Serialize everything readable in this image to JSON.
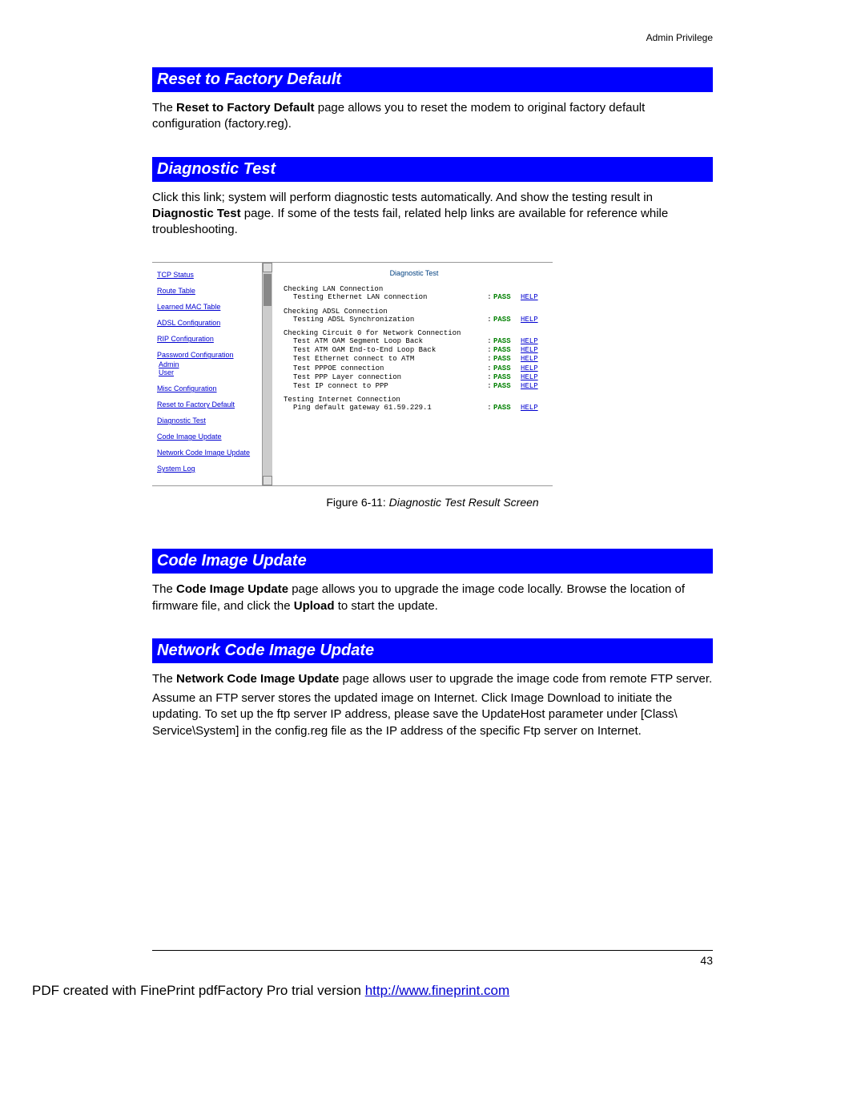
{
  "header_right": "Admin Privilege",
  "sections": {
    "reset": {
      "title": "Reset to Factory Default",
      "text_pre": "The ",
      "text_bold": "Reset to Factory Default",
      "text_post": " page allows you to reset the modem to original factory default configuration (factory.reg)."
    },
    "diag": {
      "title": "Diagnostic Test",
      "text_pre": "Click this link; system will perform diagnostic tests automatically. And show the testing result in ",
      "text_bold": "Diagnostic Test",
      "text_post": " page. If some of the tests fail, related help links are available for reference while troubleshooting."
    },
    "code": {
      "title": "Code Image Update",
      "text_pre": "The ",
      "text_bold1": "Code Image Update",
      "text_mid": " page allows you to upgrade the image code locally. Browse the location of firmware file, and click the ",
      "text_bold2": "Upload",
      "text_post": " to start the update."
    },
    "net": {
      "title": "Network Code Image Update",
      "p1_pre": "The ",
      "p1_bold": "Network Code Image Update",
      "p1_post": " page allows user to upgrade the image code from remote FTP server.",
      "p2": "Assume an FTP server stores the updated image on Internet. Click Image Download to initiate the updating. To set up the ftp server IP address, please save the UpdateHost parameter under [Class\\ Service\\System] in the config.reg file as the IP address of the specific Ftp server on Internet."
    }
  },
  "caption_prefix": "Figure 6-11: ",
  "caption_text": "Diagnostic Test Result Screen",
  "sidebar": {
    "items": [
      "TCP Status",
      "Route Table",
      "Learned MAC Table",
      "ADSL Configuration",
      "RIP Configuration"
    ],
    "pwd_label": "Password Configuration",
    "admin": "Admin",
    "user": "User",
    "items2": [
      "Misc Configuration",
      "Reset to Factory Default",
      "Diagnostic Test",
      "Code Image Update",
      "Network Code Image Update",
      "System Log"
    ]
  },
  "diag_panel": {
    "title": "Diagnostic Test",
    "groups": [
      {
        "heading": "Checking LAN Connection",
        "rows": [
          {
            "label": "Testing Ethernet LAN connection",
            "status": "PASS",
            "help": "HELP"
          }
        ]
      },
      {
        "heading": "Checking ADSL Connection",
        "rows": [
          {
            "label": "Testing ADSL Synchronization",
            "status": "PASS",
            "help": "HELP"
          }
        ]
      },
      {
        "heading": "Checking Circuit 0 for Network Connection",
        "rows": [
          {
            "label": "Test ATM OAM Segment Loop Back",
            "status": "PASS",
            "help": "HELP"
          },
          {
            "label": "Test ATM OAM End-to-End Loop Back",
            "status": "PASS",
            "help": "HELP"
          },
          {
            "label": "Test Ethernet connect to ATM",
            "status": "PASS",
            "help": "HELP"
          },
          {
            "label": "Test PPPOE connection",
            "status": "PASS",
            "help": "HELP"
          },
          {
            "label": "Test PPP Layer connection",
            "status": "PASS",
            "help": "HELP"
          },
          {
            "label": "Test IP connect to PPP",
            "status": "PASS",
            "help": "HELP"
          }
        ]
      },
      {
        "heading": "Testing Internet Connection",
        "rows": [
          {
            "label": "Ping default gateway 61.59.229.1",
            "status": "PASS",
            "help": "HELP"
          }
        ]
      }
    ]
  },
  "page_number": "43",
  "footer_pre": "PDF created with FinePrint pdfFactory Pro trial version ",
  "footer_link": "http://www.fineprint.com"
}
